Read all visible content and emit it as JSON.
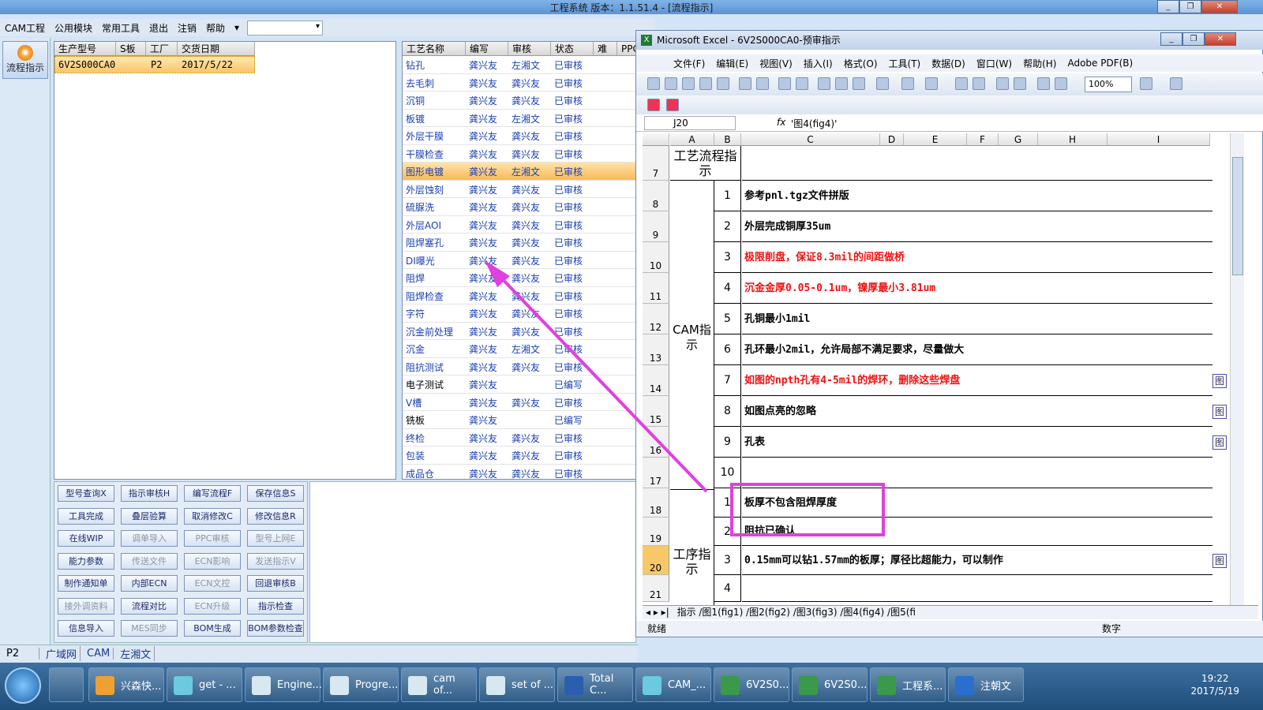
{
  "app_title": "工程系统   版本：1.1.51.4 - [流程指示]",
  "menu": {
    "items": [
      "CAM工程",
      "公用模块",
      "常用工具",
      "退出",
      "注销",
      "帮助"
    ],
    "combo_value": ""
  },
  "nav": {
    "label": "流程指示"
  },
  "product_table": {
    "headers": [
      "生产型号",
      "S板",
      "工厂",
      "交货日期"
    ],
    "row": {
      "model": "6V2S000CA0",
      "s_board": "",
      "factory": "P2",
      "date": "2017/5/22"
    }
  },
  "flow_table": {
    "headers": [
      "工艺名称",
      "编写",
      "审核",
      "状态",
      "难",
      "PPC"
    ],
    "rows": [
      {
        "name": "钻孔",
        "writer": "龚兴友",
        "reviewer": "左湘文",
        "status": "已审核"
      },
      {
        "name": "去毛刺",
        "writer": "龚兴友",
        "reviewer": "龚兴友",
        "status": "已审核"
      },
      {
        "name": "沉铜",
        "writer": "龚兴友",
        "reviewer": "龚兴友",
        "status": "已审核"
      },
      {
        "name": "板镀",
        "writer": "龚兴友",
        "reviewer": "左湘文",
        "status": "已审核"
      },
      {
        "name": "外层干膜",
        "writer": "龚兴友",
        "reviewer": "龚兴友",
        "status": "已审核"
      },
      {
        "name": "干膜检查",
        "writer": "龚兴友",
        "reviewer": "龚兴友",
        "status": "已审核"
      },
      {
        "name": "图形电镀",
        "writer": "龚兴友",
        "reviewer": "左湘文",
        "status": "已审核"
      },
      {
        "name": "外层蚀刻",
        "writer": "龚兴友",
        "reviewer": "龚兴友",
        "status": "已审核"
      },
      {
        "name": "硫脲洗",
        "writer": "龚兴友",
        "reviewer": "龚兴友",
        "status": "已审核"
      },
      {
        "name": "外层AOI",
        "writer": "龚兴友",
        "reviewer": "龚兴友",
        "status": "已审核"
      },
      {
        "name": "阻焊塞孔",
        "writer": "龚兴友",
        "reviewer": "龚兴友",
        "status": "已审核"
      },
      {
        "name": "DI曝光",
        "writer": "龚兴友",
        "reviewer": "龚兴友",
        "status": "已审核"
      },
      {
        "name": "阻焊",
        "writer": "龚兴友",
        "reviewer": "龚兴友",
        "status": "已审核"
      },
      {
        "name": "阻焊检查",
        "writer": "龚兴友",
        "reviewer": "龚兴友",
        "status": "已审核"
      },
      {
        "name": "字符",
        "writer": "龚兴友",
        "reviewer": "龚兴友",
        "status": "已审核"
      },
      {
        "name": "沉金前处理",
        "writer": "龚兴友",
        "reviewer": "龚兴友",
        "status": "已审核"
      },
      {
        "name": "沉金",
        "writer": "龚兴友",
        "reviewer": "左湘文",
        "status": "已审核"
      },
      {
        "name": "阻抗测试",
        "writer": "龚兴友",
        "reviewer": "龚兴友",
        "status": "已审核"
      },
      {
        "name": "电子测试",
        "writer": "龚兴友",
        "reviewer": "",
        "status": "已编写"
      },
      {
        "name": "V槽",
        "writer": "龚兴友",
        "reviewer": "龚兴友",
        "status": "已审核"
      },
      {
        "name": "铣板",
        "writer": "龚兴友",
        "reviewer": "",
        "status": "已编写"
      },
      {
        "name": "终检",
        "writer": "龚兴友",
        "reviewer": "龚兴友",
        "status": "已审核"
      },
      {
        "name": "包装",
        "writer": "龚兴友",
        "reviewer": "龚兴友",
        "status": "已审核"
      },
      {
        "name": "成品仓",
        "writer": "龚兴友",
        "reviewer": "龚兴友",
        "status": "已审核"
      }
    ]
  },
  "buttons": [
    {
      "label": "型号查询X",
      "enabled": true
    },
    {
      "label": "指示审核H",
      "enabled": true
    },
    {
      "label": "编写流程F",
      "enabled": true
    },
    {
      "label": "保存信息S",
      "enabled": true
    },
    {
      "label": "工具完成",
      "enabled": true
    },
    {
      "label": "叠层验算",
      "enabled": true
    },
    {
      "label": "取消修改C",
      "enabled": true
    },
    {
      "label": "修改信息R",
      "enabled": true
    },
    {
      "label": "在线WIP",
      "enabled": true
    },
    {
      "label": "调单导入",
      "enabled": false
    },
    {
      "label": "PPC审核",
      "enabled": false
    },
    {
      "label": "型号上网E",
      "enabled": false
    },
    {
      "label": "能力参数",
      "enabled": true
    },
    {
      "label": "传送文件",
      "enabled": false
    },
    {
      "label": "ECN影响",
      "enabled": false
    },
    {
      "label": "发送指示V",
      "enabled": false
    },
    {
      "label": "制作通知单",
      "enabled": true
    },
    {
      "label": "内部ECN",
      "enabled": true
    },
    {
      "label": "ECN文控",
      "enabled": false
    },
    {
      "label": "回退审核B",
      "enabled": true
    },
    {
      "label": "接外调资料",
      "enabled": false
    },
    {
      "label": "流程对比",
      "enabled": true
    },
    {
      "label": "ECN升级",
      "enabled": false
    },
    {
      "label": "指示检查",
      "enabled": true
    },
    {
      "label": "信息导入",
      "enabled": true
    },
    {
      "label": "MES同步",
      "enabled": false
    },
    {
      "label": "BOM生成",
      "enabled": true
    },
    {
      "label": "BOM参数检查",
      "enabled": true
    }
  ],
  "statusbar": {
    "factory": "P2",
    "items": [
      "广域网",
      "CAM",
      "左湘文"
    ]
  },
  "excel": {
    "title": "Microsoft Excel - 6V2S000CA0-预审指示",
    "menu": [
      "文件(F)",
      "编辑(E)",
      "视图(V)",
      "插入(I)",
      "格式(O)",
      "工具(T)",
      "数据(D)",
      "窗口(W)",
      "帮助(H)",
      "Adobe PDF(B)"
    ],
    "zoom": "100%",
    "namebox": "J20",
    "formula": "'图4(fig4)'",
    "columns": [
      "A",
      "B",
      "C",
      "D",
      "E",
      "F",
      "G",
      "H",
      "I"
    ],
    "section_headers": {
      "process_flow": "工艺流程指示",
      "cam": "CAM指示",
      "procedure": "工序指示"
    },
    "rows": [
      {
        "row": "7",
        "num": "",
        "text": "",
        "red": false,
        "mark": ""
      },
      {
        "row": "8",
        "num": "1",
        "text": "参考pnl.tgz文件拼版",
        "red": false,
        "mark": ""
      },
      {
        "row": "9",
        "num": "2",
        "text": "外层完成铜厚35um",
        "red": false,
        "mark": ""
      },
      {
        "row": "10",
        "num": "3",
        "text": "极限削盘，保证8.3mil的间距做桥",
        "red": true,
        "mark": ""
      },
      {
        "row": "11",
        "num": "4",
        "text": "沉金金厚0.05-0.1um，镍厚最小3.81um",
        "red": true,
        "mark": ""
      },
      {
        "row": "12",
        "num": "5",
        "text": "孔铜最小1mil",
        "red": false,
        "mark": ""
      },
      {
        "row": "13",
        "num": "6",
        "text": "孔环最小2mil，允许局部不满足要求，尽量做大",
        "red": false,
        "mark": ""
      },
      {
        "row": "14",
        "num": "7",
        "text": "如图的npth孔有4-5mil的焊环，删除这些焊盘",
        "red": true,
        "mark": "图"
      },
      {
        "row": "15",
        "num": "8",
        "text": "如图点亮的忽略",
        "red": false,
        "mark": "图"
      },
      {
        "row": "16",
        "num": "9",
        "text": "孔表",
        "red": false,
        "mark": "图"
      },
      {
        "row": "17",
        "num": "10",
        "text": "",
        "red": false,
        "mark": ""
      },
      {
        "row": "18",
        "num": "1",
        "text": "板厚不包含阻焊厚度",
        "red": false,
        "mark": ""
      },
      {
        "row": "19",
        "num": "2",
        "text": "阻抗已确认",
        "red": false,
        "mark": ""
      },
      {
        "row": "20",
        "num": "3",
        "text": "0.15mm可以钻1.57mm的板厚；厚径比超能力，可以制作",
        "red": false,
        "mark": "图"
      },
      {
        "row": "21",
        "num": "4",
        "text": "",
        "red": false,
        "mark": ""
      }
    ],
    "sheet_tabs": "指示 /图1(fig1) /图2(fig2) /图3(fig3) /图4(fig4) /图5(fi",
    "status_left": "就绪",
    "status_right": "数字"
  },
  "taskbar": {
    "items": [
      "兴森快...",
      "get - ...",
      "Engine...",
      "Progre...",
      "cam of...",
      "set of ...",
      "Total C...",
      "CAM_...",
      "6V2S0...",
      "6V2S0...",
      "工程系...",
      "注朝文"
    ],
    "time": "19:22",
    "date": "2017/5/19"
  },
  "colors": {
    "accent": "#e040e0",
    "selected_row": "#f9b95a",
    "red_text": "#e11111"
  }
}
